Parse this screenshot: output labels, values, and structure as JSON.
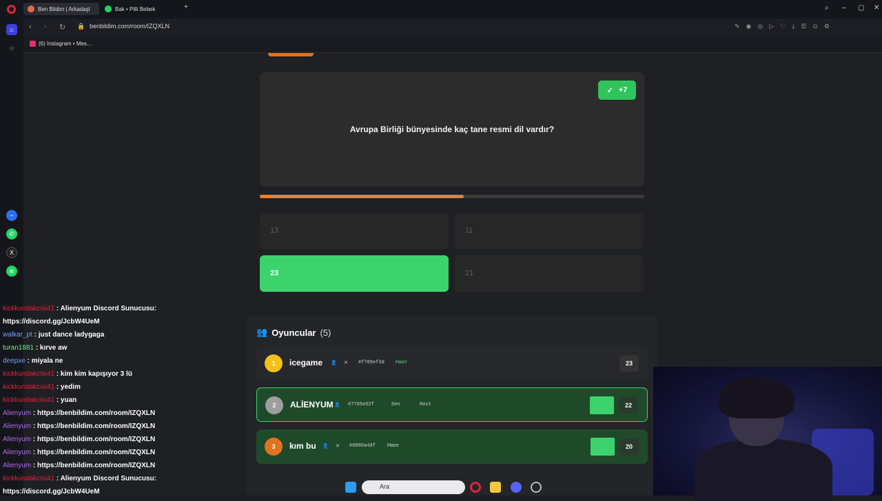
{
  "browser": {
    "tabs": [
      {
        "label": "Ben Bildim | Arkadaşl",
        "active": true
      },
      {
        "label": "Bak • Pilli Bebek",
        "active": false
      }
    ],
    "new_tab": "+",
    "url": "benbildim.com/room/IZQXLN",
    "bookmark": "(6) Instagram • Mes..."
  },
  "question": {
    "badge": "+7",
    "text": "Avrupa Birliği bünyesinde kaç tane resmi dil vardır?",
    "progress_fraction": 0.53
  },
  "answers": [
    {
      "label": "13",
      "correct": false
    },
    {
      "label": "11",
      "correct": false
    },
    {
      "label": "23",
      "correct": true
    },
    {
      "label": "21",
      "correct": false
    }
  ],
  "players": {
    "title": "Oyuncular",
    "count": "(5)",
    "rows": [
      {
        "rank": "1",
        "name": "icegame",
        "id": "#f709ef3d",
        "status": "Hazır",
        "score": "23",
        "rank_color": "#f2c21a",
        "style": "plain"
      },
      {
        "rank": "2",
        "name": "ALİENYUM",
        "id": "#7765e62f",
        "self": "Sen",
        "status": "Host",
        "score": "22",
        "rank_color": "#9e9e9e",
        "style": "highlight"
      },
      {
        "rank": "3",
        "name": "kım bu",
        "id": "#8880a4df",
        "status": "Hazır",
        "score": "20",
        "rank_color": "#e0731f",
        "style": "green"
      }
    ]
  },
  "chat": [
    {
      "user": "kickkundakcisi41",
      "color": "u-red",
      "text": ": Alienyum Discord Sunucusu:"
    },
    {
      "user": "",
      "color": "",
      "text": "https://discord.gg/JcbW4UeM"
    },
    {
      "user": "walkar_pt",
      "color": "u-blue",
      "text": ": just dance ladygaga"
    },
    {
      "user": "turan1881",
      "color": "u-green",
      "text": ": kırve aw"
    },
    {
      "user": "deepxe",
      "color": "u-blue",
      "text": ": miyala ne"
    },
    {
      "user": "kickkundakcisi41",
      "color": "u-red",
      "text": ": kim kim kapışıyor 3 lü"
    },
    {
      "user": "kickkundakcisi41",
      "color": "u-red",
      "text": ": yedim"
    },
    {
      "user": "kickkundakcisi41",
      "color": "u-red",
      "text": ": yuan"
    },
    {
      "user": "Alienyum",
      "color": "u-purple",
      "text": ": https://benbildim.com/room/IZQXLN"
    },
    {
      "user": "Alienyum",
      "color": "u-purple",
      "text": ": https://benbildim.com/room/IZQXLN"
    },
    {
      "user": "Alienyum",
      "color": "u-purple",
      "text": ": https://benbildim.com/room/IZQXLN"
    },
    {
      "user": "Alienyum",
      "color": "u-purple",
      "text": ": https://benbildim.com/room/IZQXLN"
    },
    {
      "user": "Alienyum",
      "color": "u-purple",
      "text": ": https://benbildim.com/room/IZQXLN"
    },
    {
      "user": "kickkundakcisi41",
      "color": "u-red",
      "text": ": Alienyum Discord Sunucusu:"
    },
    {
      "user": "",
      "color": "",
      "text": "https://discord.gg/JcbW4UeM"
    }
  ],
  "taskbar": {
    "search_label": "Ara"
  }
}
